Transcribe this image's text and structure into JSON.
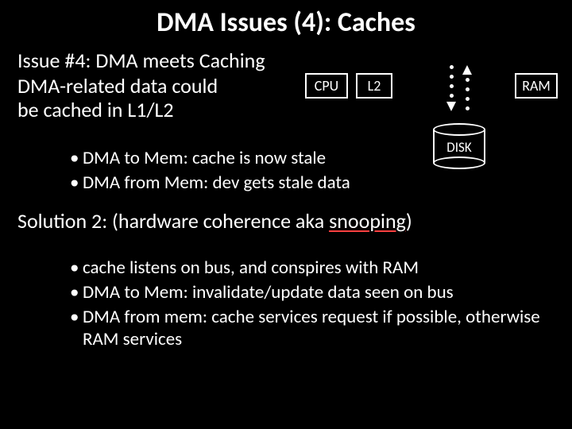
{
  "title": "DMA Issues (4): Caches",
  "issue": "Issue #4: DMA meets Caching",
  "desc1": "DMA-related data could",
  "desc2": "be cached in L1/L2",
  "boxes": {
    "cpu": "CPU",
    "l2": "L2",
    "ram": "RAM",
    "disk": "DISK"
  },
  "bullets_a": [
    "DMA to Mem: cache is now stale",
    "DMA from Mem: dev gets stale data"
  ],
  "solution_prefix": "Solution 2: (hardware coherence aka ",
  "solution_snoop": "snooping",
  "solution_suffix": ")",
  "bullets_b": [
    "cache listens on bus, and conspires with RAM",
    "DMA to Mem: invalidate/update data seen on bus",
    "DMA from mem: cache services request if possible, otherwise RAM services"
  ]
}
